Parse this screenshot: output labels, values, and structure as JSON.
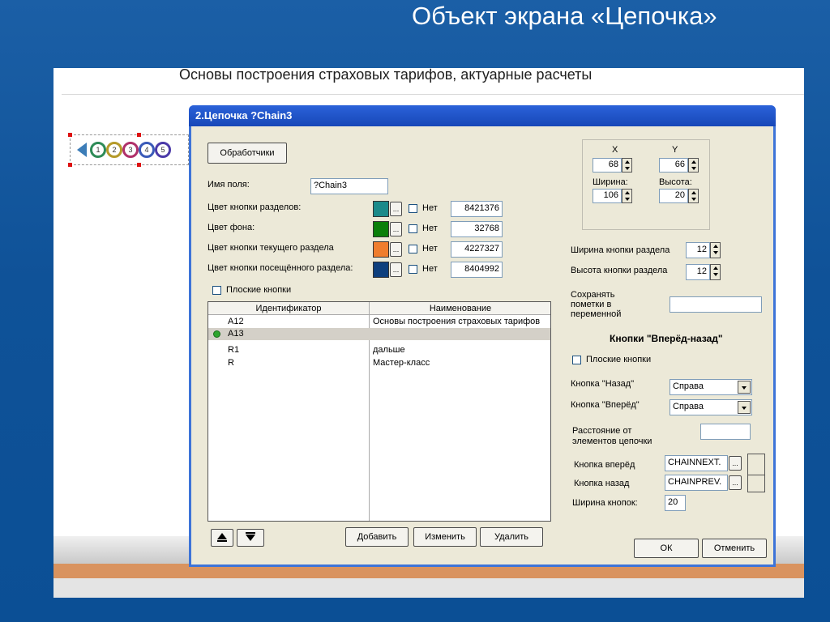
{
  "slide_title": "Объект экрана «Цепочка»",
  "screenshot": {
    "header": "Основы построения страховых тарифов, актуарные расчеты",
    "chain_preview": [
      "1",
      "2",
      "3",
      "4",
      "5"
    ]
  },
  "dialog": {
    "title": "2.Цепочка ?Chain3",
    "handlers_button": "Обработчики",
    "field_name_label": "Имя поля:",
    "field_name_value": "?Chain3",
    "colors": [
      {
        "label": "Цвет кнопки разделов:",
        "color": "#1a8a8a",
        "none": "Нет",
        "value": "8421376"
      },
      {
        "label": "Цвет фона:",
        "color": "#0a7f0a",
        "none": "Нет",
        "value": "32768"
      },
      {
        "label": "Цвет кнопки текущего раздела",
        "color": "#ef7d2e",
        "none": "Нет",
        "value": "4227327"
      },
      {
        "label": "Цвет кнопки посещённого раздела:",
        "color": "#0e3f7d",
        "none": "Нет",
        "value": "8404992"
      }
    ],
    "dots": "...",
    "flat_buttons": "Плоские кнопки",
    "table": {
      "headers": [
        "Идентификатор",
        "Наименование"
      ],
      "rows": [
        {
          "id": "A12",
          "name": "Основы построения страховых тарифов"
        },
        {
          "id": "A13",
          "name": ""
        },
        {
          "id": "R1",
          "name": "дальше"
        },
        {
          "id": "R",
          "name": "Мастер-класс"
        }
      ]
    },
    "add": "Добавить",
    "edit": "Изменить",
    "delete": "Удалить",
    "position": {
      "x_label": "X",
      "y_label": "Y",
      "x": "68",
      "y": "66",
      "w_label": "Ширина:",
      "h_label": "Высота:",
      "w": "106",
      "h": "20"
    },
    "section_width_label": "Ширина кнопки раздела",
    "section_width": "12",
    "section_height_label": "Высота кнопки раздела",
    "section_height": "12",
    "save_marks_label": "Сохранять пометки в переменной",
    "save_marks_value": "",
    "nav_heading": "Кнопки \"Вперёд-назад\"",
    "nav_flat": "Плоские кнопки",
    "back_label": "Кнопка \"Назад\"",
    "back_value": "Справа",
    "fwd_label": "Кнопка \"Вперёд\"",
    "fwd_value": "Справа",
    "distance_label": "Расстояние от элементов цепочки",
    "distance_value": "",
    "next_label": "Кнопка вперёд",
    "next_value": "CHAINNEXT.",
    "prev_label": "Кнопка назад",
    "prev_value": "CHAINPREV.",
    "btn_width_label": "Ширина кнопок:",
    "btn_width": "20",
    "ok": "ОК",
    "cancel": "Отменить"
  }
}
